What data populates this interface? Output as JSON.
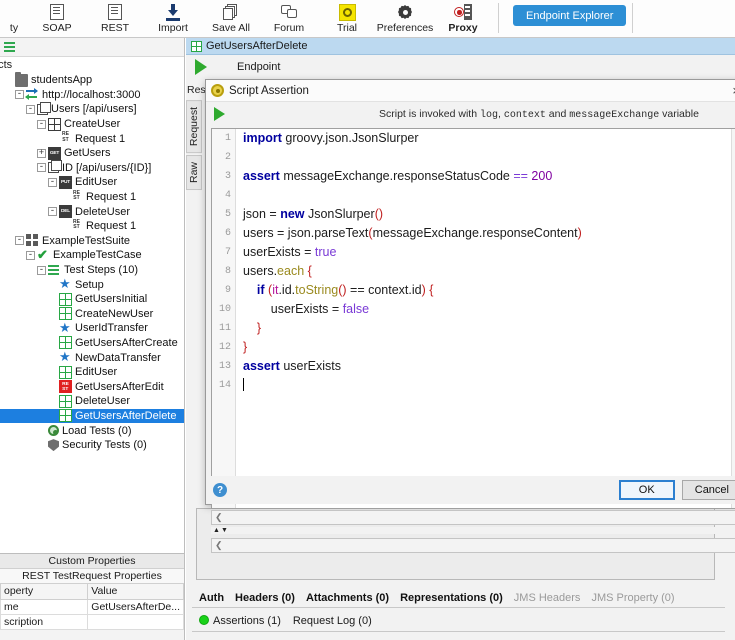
{
  "toolbar": {
    "items": [
      {
        "label": "ty",
        "icon": "empty-icon",
        "bold": false
      },
      {
        "label": "SOAP",
        "icon": "soap-icon",
        "bold": false
      },
      {
        "label": "REST",
        "icon": "rest-icon",
        "bold": false
      },
      {
        "label": "Import",
        "icon": "import-icon",
        "bold": false
      },
      {
        "label": "Save All",
        "icon": "save-all-icon",
        "bold": false
      },
      {
        "label": "Forum",
        "icon": "forum-icon",
        "bold": false
      },
      {
        "label": "Trial",
        "icon": "trial-icon",
        "bold": false
      },
      {
        "label": "Preferences",
        "icon": "gear-icon",
        "bold": false
      },
      {
        "label": "Proxy",
        "icon": "proxy-icon",
        "bold": true
      }
    ],
    "endpoint_explorer": "Endpoint Explorer"
  },
  "navigator": {
    "header": "ects",
    "tree": [
      {
        "label": "studentsApp",
        "indent": 0,
        "toggle": "",
        "icon": "folder-icon"
      },
      {
        "label": "http://localhost:3000",
        "indent": 1,
        "toggle": "-",
        "icon": "interface-icon"
      },
      {
        "label": "Users [/api/users]",
        "indent": 2,
        "toggle": "-",
        "icon": "resource-icon"
      },
      {
        "label": "CreateUser",
        "indent": 3,
        "toggle": "-",
        "icon": "post-method-icon"
      },
      {
        "label": "Request 1",
        "indent": 4,
        "toggle": "",
        "icon": "rest-request-icon"
      },
      {
        "label": "GetUsers",
        "indent": 3,
        "toggle": "+",
        "icon": "get-method-icon"
      },
      {
        "label": "ID [/api/users/{ID}]",
        "indent": 3,
        "toggle": "-",
        "icon": "resource-icon"
      },
      {
        "label": "EditUser",
        "indent": 4,
        "toggle": "-",
        "icon": "put-method-icon"
      },
      {
        "label": "Request 1",
        "indent": 5,
        "toggle": "",
        "icon": "rest-request-icon"
      },
      {
        "label": "DeleteUser",
        "indent": 4,
        "toggle": "-",
        "icon": "del-method-icon"
      },
      {
        "label": "Request 1",
        "indent": 5,
        "toggle": "",
        "icon": "rest-request-icon"
      },
      {
        "label": "ExampleTestSuite",
        "indent": 1,
        "toggle": "-",
        "icon": "test-suite-icon"
      },
      {
        "label": "ExampleTestCase",
        "indent": 2,
        "toggle": "-",
        "icon": "test-case-icon"
      },
      {
        "label": "Test Steps (10)",
        "indent": 3,
        "toggle": "-",
        "icon": "test-steps-icon"
      },
      {
        "label": "Setup",
        "indent": 4,
        "toggle": "",
        "icon": "groovy-step-icon"
      },
      {
        "label": "GetUsersInitial",
        "indent": 4,
        "toggle": "",
        "icon": "rest-step-ok-icon"
      },
      {
        "label": "CreateNewUser",
        "indent": 4,
        "toggle": "",
        "icon": "rest-step-ok-icon"
      },
      {
        "label": "UserIdTransfer",
        "indent": 4,
        "toggle": "",
        "icon": "groovy-step-icon"
      },
      {
        "label": "GetUsersAfterCreate",
        "indent": 4,
        "toggle": "",
        "icon": "rest-step-ok-icon"
      },
      {
        "label": "NewDataTransfer",
        "indent": 4,
        "toggle": "",
        "icon": "groovy-step-icon"
      },
      {
        "label": "EditUser",
        "indent": 4,
        "toggle": "",
        "icon": "rest-step-ok-icon"
      },
      {
        "label": "GetUsersAfterEdit",
        "indent": 4,
        "toggle": "",
        "icon": "rest-step-fail-icon"
      },
      {
        "label": "DeleteUser",
        "indent": 4,
        "toggle": "",
        "icon": "rest-step-ok-icon"
      },
      {
        "label": "GetUsersAfterDelete",
        "indent": 4,
        "toggle": "",
        "icon": "rest-step-ok-icon",
        "selected": true
      },
      {
        "label": "Load Tests (0)",
        "indent": 3,
        "toggle": "",
        "icon": "load-test-icon"
      },
      {
        "label": "Security Tests (0)",
        "indent": 3,
        "toggle": "",
        "icon": "security-test-icon"
      }
    ]
  },
  "properties": {
    "tab_custom": "Custom Properties",
    "tab_rest": "REST TestRequest Properties",
    "columns": [
      "operty",
      "Value"
    ],
    "rows": [
      {
        "name": "me",
        "value": "GetUsersAfterDe..."
      },
      {
        "name": "scription",
        "value": ""
      }
    ]
  },
  "main": {
    "doc_title": "GetUsersAfterDelete",
    "endpoint_label": "Endpoint",
    "response_vtab": "Res",
    "vtabs": [
      "Request",
      "Raw"
    ],
    "tabs_row1": [
      {
        "label": "Auth",
        "bold": true,
        "dim": false
      },
      {
        "label": "Headers (0)",
        "bold": true,
        "dim": false
      },
      {
        "label": "Attachments (0)",
        "bold": true,
        "dim": false
      },
      {
        "label": "Representations (0)",
        "bold": true,
        "dim": false
      },
      {
        "label": "JMS Headers",
        "bold": false,
        "dim": true
      },
      {
        "label": "JMS Property (0)",
        "bold": false,
        "dim": true
      }
    ],
    "tabs_row2": [
      {
        "label": "Assertions (1)",
        "has_dot": true
      },
      {
        "label": "Request Log (0)",
        "has_dot": false
      }
    ]
  },
  "dialog": {
    "title": "Script Assertion",
    "close_label": "×",
    "hint_prefix": "Script is invoked with ",
    "hint_mono1": "log",
    "hint_mid": ", ",
    "hint_mono2": "context",
    "hint_and": " and ",
    "hint_mono3": "messageExchange",
    "hint_suffix": " variable",
    "ok_label": "OK",
    "cancel_label": "Cancel",
    "help_label": "?",
    "script_lines": [
      {
        "n": "1",
        "tokens": [
          {
            "t": "import",
            "c": "kw"
          },
          {
            "t": " groovy.json.JsonSlurper",
            "c": ""
          }
        ]
      },
      {
        "n": "2",
        "tokens": []
      },
      {
        "n": "3",
        "tokens": [
          {
            "t": "assert",
            "c": "kw"
          },
          {
            "t": " messageExchange.responseStatusCode ",
            "c": ""
          },
          {
            "t": "==",
            "c": "op"
          },
          {
            "t": " ",
            "c": ""
          },
          {
            "t": "200",
            "c": "num"
          }
        ]
      },
      {
        "n": "4",
        "tokens": []
      },
      {
        "n": "5",
        "tokens": [
          {
            "t": "json = ",
            "c": ""
          },
          {
            "t": "new",
            "c": "kw"
          },
          {
            "t": " JsonSlurper",
            "c": ""
          },
          {
            "t": "()",
            "c": "paren"
          }
        ]
      },
      {
        "n": "6",
        "tokens": [
          {
            "t": "users = json.parseText",
            "c": ""
          },
          {
            "t": "(",
            "c": "paren"
          },
          {
            "t": "messageExchange.responseContent",
            "c": ""
          },
          {
            "t": ")",
            "c": "paren"
          }
        ]
      },
      {
        "n": "7",
        "tokens": [
          {
            "t": "userExists = ",
            "c": ""
          },
          {
            "t": "true",
            "c": "bool"
          }
        ]
      },
      {
        "n": "8",
        "tokens": [
          {
            "t": "users.",
            "c": ""
          },
          {
            "t": "each",
            "c": "meth"
          },
          {
            "t": " ",
            "c": ""
          },
          {
            "t": "{",
            "c": "paren"
          }
        ]
      },
      {
        "n": "9",
        "tokens": [
          {
            "t": "    ",
            "c": ""
          },
          {
            "t": "if",
            "c": "kw"
          },
          {
            "t": " ",
            "c": ""
          },
          {
            "t": "(",
            "c": "paren"
          },
          {
            "t": "it",
            "c": "var"
          },
          {
            "t": ".id.",
            "c": ""
          },
          {
            "t": "toString",
            "c": "meth"
          },
          {
            "t": "()",
            "c": "paren"
          },
          {
            "t": " == context.id",
            "c": ""
          },
          {
            "t": ")",
            "c": "paren"
          },
          {
            "t": " ",
            "c": ""
          },
          {
            "t": "{",
            "c": "paren"
          }
        ]
      },
      {
        "n": "10",
        "tokens": [
          {
            "t": "        userExists = ",
            "c": ""
          },
          {
            "t": "false",
            "c": "bool"
          }
        ]
      },
      {
        "n": "11",
        "tokens": [
          {
            "t": "    ",
            "c": ""
          },
          {
            "t": "}",
            "c": "paren"
          }
        ]
      },
      {
        "n": "12",
        "tokens": [
          {
            "t": "}",
            "c": "paren"
          }
        ]
      },
      {
        "n": "13",
        "tokens": [
          {
            "t": "assert",
            "c": "kw"
          },
          {
            "t": " userExists",
            "c": ""
          }
        ]
      },
      {
        "n": "14",
        "tokens": [
          {
            "t": "",
            "c": "caret"
          }
        ]
      }
    ]
  }
}
